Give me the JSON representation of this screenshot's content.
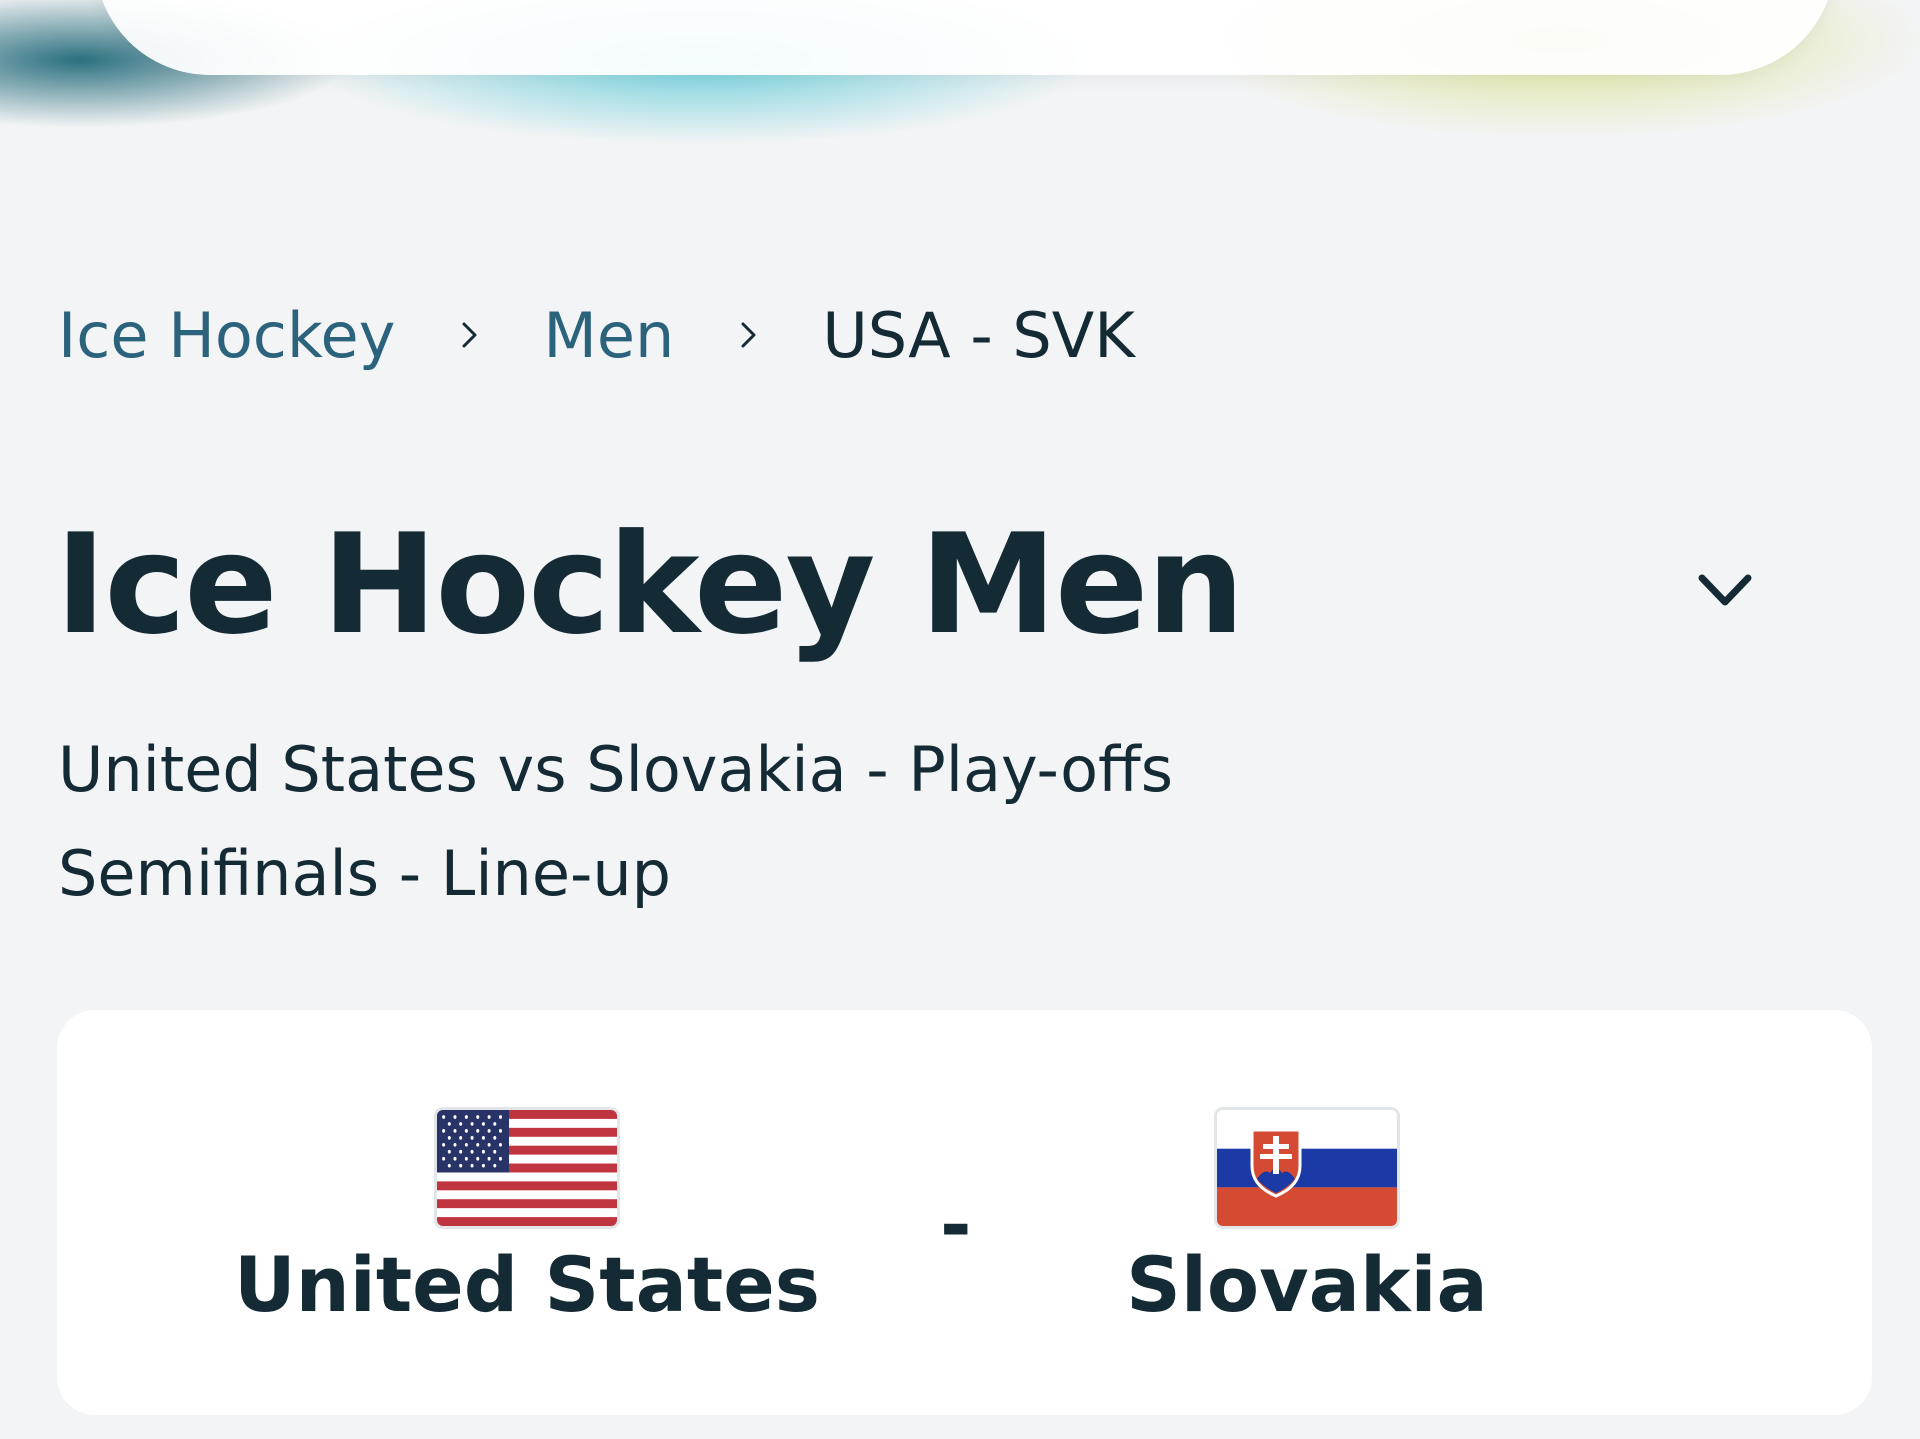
{
  "breadcrumb": {
    "items": [
      "Ice Hockey",
      "Men"
    ],
    "current": "USA - SVK"
  },
  "title": "Ice Hockey Men",
  "subtitle": {
    "line1": "United States vs Slovakia - Play-offs",
    "line2": "Semifinals - Line-up"
  },
  "match": {
    "home_team": "United States",
    "away_team": "Slovakia",
    "separator": "-"
  },
  "colors": {
    "link": "#2b627c",
    "text": "#142a35",
    "background": "#f3f4f5",
    "card": "#ffffff"
  },
  "icons": {
    "breadcrumb_separator": "chevron-right-icon",
    "title_toggle": "chevron-down-icon"
  }
}
